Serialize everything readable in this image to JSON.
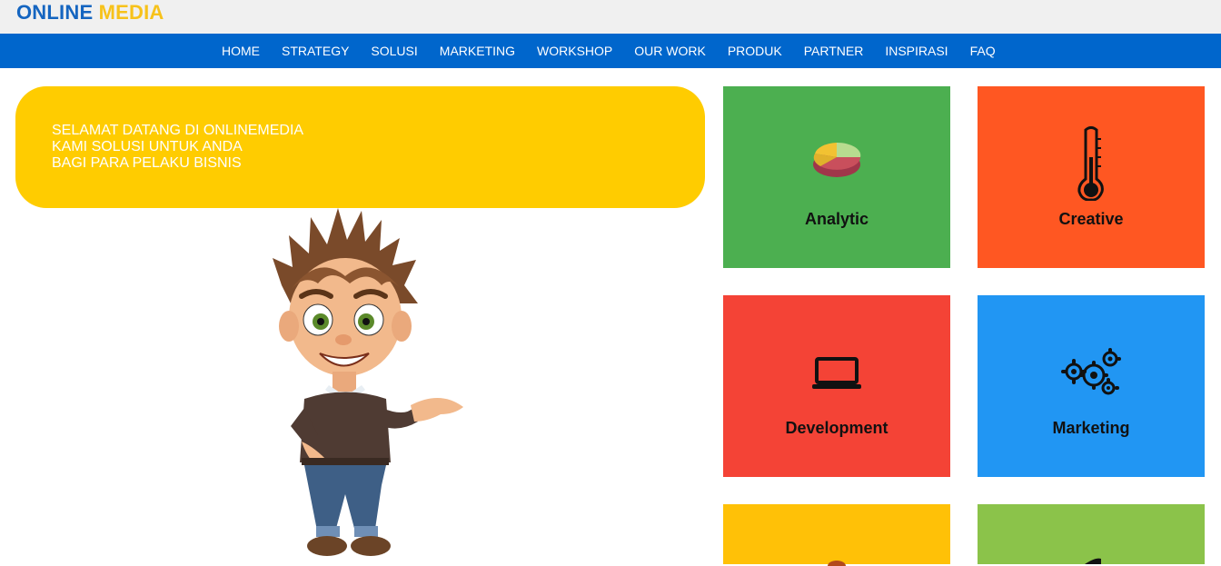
{
  "brand": {
    "part1": "ONLINE",
    "part2": "MEDIA"
  },
  "nav": [
    "HOME",
    "STRATEGY",
    "SOLUSI",
    "MARKETING",
    "WORKSHOP",
    "OUR WORK",
    "PRODUK",
    "PARTNER",
    "INSPIRASI",
    "FAQ"
  ],
  "welcome": {
    "line1": "SELAMAT DATANG DI ONLINEMEDIA",
    "line2": "KAMI SOLUSI UNTUK ANDA",
    "line3": "BAGI PARA PELAKU BISNIS"
  },
  "tiles": [
    {
      "label": "Analytic",
      "icon": "pie-chart-icon",
      "color": "#4caf50"
    },
    {
      "label": "Creative",
      "icon": "thermometer-icon",
      "color": "#ff5722"
    },
    {
      "label": "Development",
      "icon": "laptop-icon",
      "color": "#f44336"
    },
    {
      "label": "Marketing",
      "icon": "gears-icon",
      "color": "#2196f3"
    },
    {
      "label": "",
      "icon": "",
      "color": "#ffc107"
    },
    {
      "label": "",
      "icon": "",
      "color": "#8bc34a"
    }
  ],
  "colors": {
    "topbar": "#f0f0f0",
    "navbar": "#0066cc",
    "brand_blue": "#1565c0",
    "brand_yellow": "#f7c21a",
    "welcome_bg": "#ffcc00"
  }
}
